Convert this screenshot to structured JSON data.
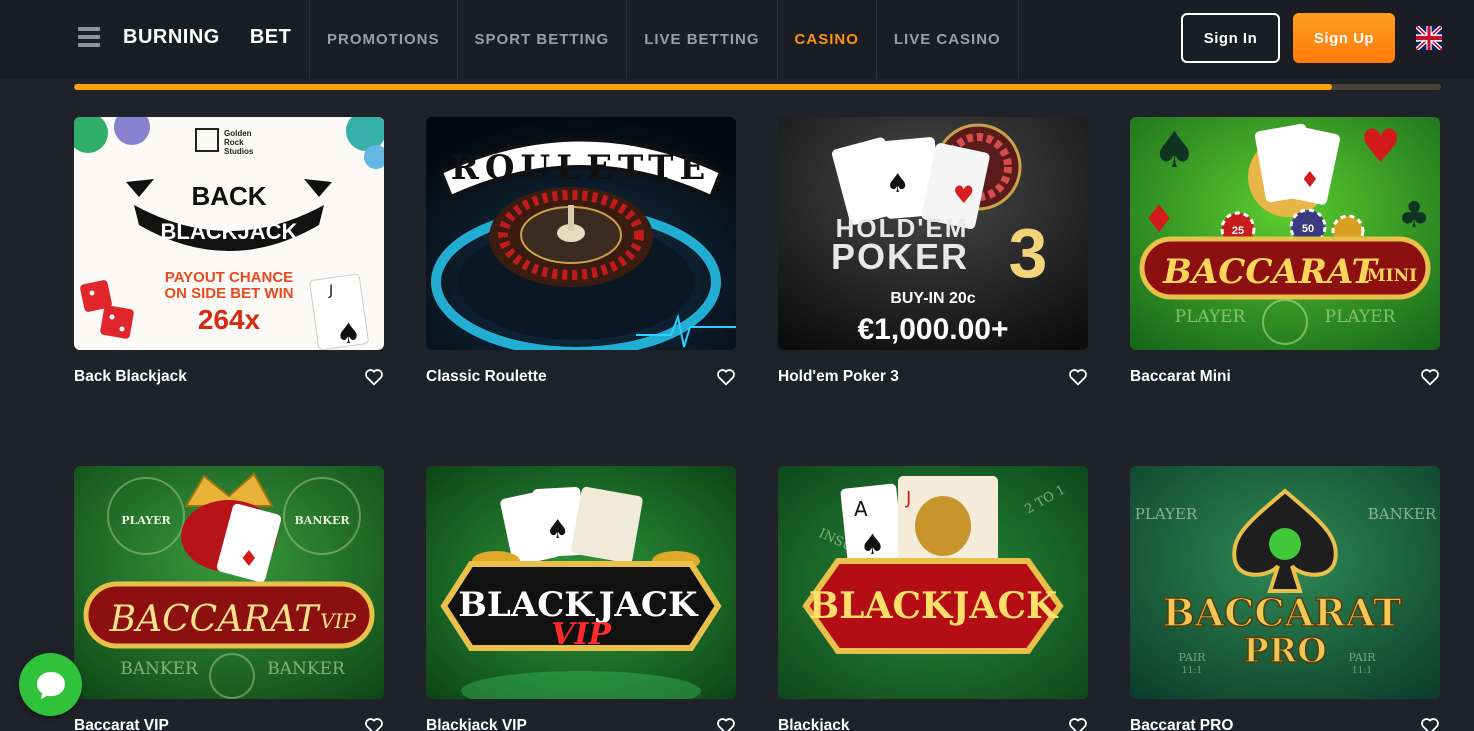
{
  "header": {
    "brand_word1": "BURNING",
    "brand_word2": "BET",
    "nav": [
      {
        "label": "PROMOTIONS",
        "active": false
      },
      {
        "label": "SPORT BETTING",
        "active": false
      },
      {
        "label": "LIVE BETTING",
        "active": false
      },
      {
        "label": "CASINO",
        "active": true
      },
      {
        "label": "LIVE CASINO",
        "active": false
      }
    ],
    "signin_label": "Sign In",
    "signup_label": "Sign Up",
    "language_icon": "uk-flag-icon"
  },
  "progress": {
    "fraction": 0.92
  },
  "colors": {
    "accent": "#ff9315",
    "background": "#1f2229",
    "header": "#1a1d23",
    "chat": "#2fc23a"
  },
  "games": [
    {
      "title": "Back Blackjack",
      "art": {
        "studio_line1": "Golden",
        "studio_line2": "Rock",
        "studio_line3": "Studios",
        "line1": "BACK",
        "line2": "BLACKJACK",
        "promo1": "PAYOUT CHANCE",
        "promo2": "ON SIDE BET WIN",
        "promo3": "264x"
      }
    },
    {
      "title": "Classic Roulette",
      "art": {
        "line1": "ROULETTE"
      }
    },
    {
      "title": "Hold'em Poker 3",
      "art": {
        "line1": "HOLD'EM",
        "line2": "POKER",
        "line3": "3",
        "promo1": "BUY-IN 20c",
        "promo2": "€1,000.00+"
      }
    },
    {
      "title": "Baccarat Mini",
      "art": {
        "line1": "BACCARAT",
        "line2": "MINI",
        "promo1": "PLAYER",
        "promo2": "PLAYER",
        "chip1": "25",
        "chip2": "50"
      }
    },
    {
      "title": "Baccarat VIP",
      "art": {
        "line1": "BACCARAT",
        "line2": "VIP",
        "promo1": "PLAYER",
        "promo2": "BANKER",
        "promo3": "BANKER",
        "promo4": "BANKER"
      }
    },
    {
      "title": "Blackjack VIP",
      "art": {
        "line1": "BLACK",
        "line2": "JACK",
        "line3": "VIP"
      }
    },
    {
      "title": "Blackjack",
      "art": {
        "line1": "BLACKJACK",
        "promo1": "INSURANCE",
        "promo2": "2 TO 1"
      }
    },
    {
      "title": "Baccarat PRO",
      "art": {
        "line1": "BACCARAT",
        "line2": "PRO",
        "promo1": "PLAYER",
        "promo2": "BANKER",
        "promo3": "PAIR",
        "promo4": "PAIR",
        "promo5": "11:1",
        "promo6": "11:1"
      }
    }
  ],
  "chat": {
    "icon": "chat-bubble-icon"
  }
}
